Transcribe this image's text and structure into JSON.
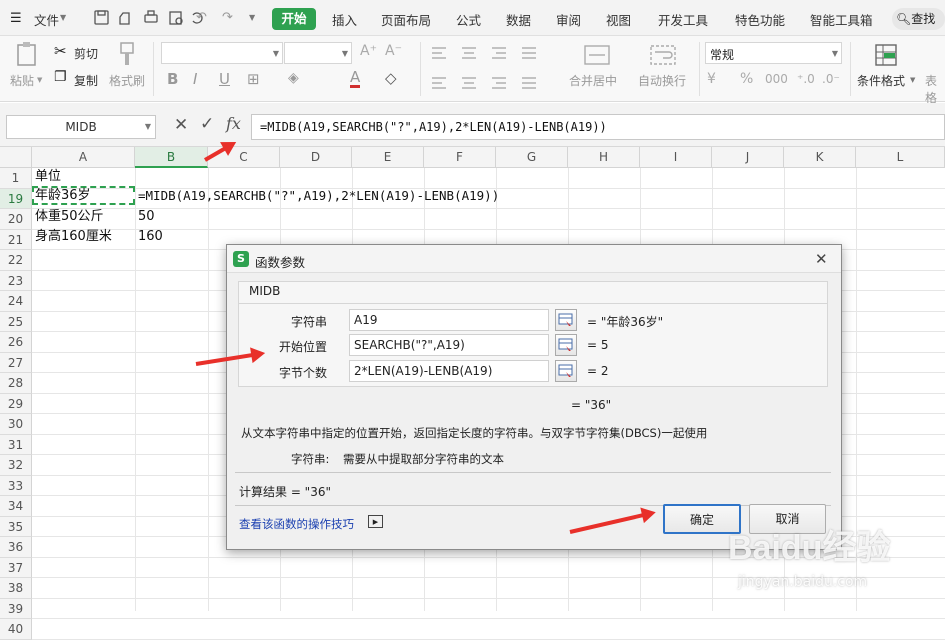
{
  "menubar": {
    "file": "文件",
    "tabs": [
      "开始",
      "插入",
      "页面布局",
      "公式",
      "数据",
      "审阅",
      "视图",
      "开发工具",
      "特色功能",
      "智能工具箱"
    ],
    "active_tab": "开始",
    "search": "查找"
  },
  "ribbon": {
    "paste": "粘贴",
    "cut": "剪切",
    "copy": "复制",
    "format_painter": "格式刷",
    "bold": "B",
    "italic": "I",
    "underline": "U",
    "merge": "合并居中",
    "wrap": "自动换行",
    "number_format": "常规",
    "conditional_format": "条件格式",
    "table_format": "表格"
  },
  "formula_bar": {
    "name_box": "MIDB",
    "fx": "fx",
    "formula": "=MIDB(A19,SEARCHB(\"?\",A19),2*LEN(A19)-LENB(A19))"
  },
  "columns": [
    "A",
    "B",
    "C",
    "D",
    "E",
    "F",
    "G",
    "H",
    "I",
    "J",
    "K",
    "L"
  ],
  "rows": [
    "1",
    "19",
    "20",
    "21",
    "22",
    "23",
    "24",
    "25",
    "26",
    "27",
    "28",
    "29",
    "30",
    "31",
    "32",
    "33",
    "34",
    "35",
    "36",
    "37",
    "38",
    "39",
    "40"
  ],
  "cells": {
    "A1": "单位",
    "A19": "年龄36岁",
    "B19": "=MIDB(A19,SEARCHB(\"?\",A19),2*LEN(A19)-LENB(A19))",
    "A20": "体重50公斤",
    "B20": "50",
    "A21": "身高160厘米",
    "B21": "160"
  },
  "dialog": {
    "title": "函数参数",
    "function_name": "MIDB",
    "args": [
      {
        "label": "字符串",
        "value": "A19",
        "result": "= \"年龄36岁\""
      },
      {
        "label": "开始位置",
        "value": "SEARCHB(\"?\",A19)",
        "result": "= 5"
      },
      {
        "label": "字节个数",
        "value": "2*LEN(A19)-LENB(A19)",
        "result": "= 2"
      }
    ],
    "overall_result": "= \"36\"",
    "description": "从文本字符串中指定的位置开始，返回指定长度的字符串。与双字节字符集(DBCS)一起使用",
    "param_help_label": "字符串:",
    "param_help_text": "需要从中提取部分字符串的文本",
    "calc_result": "计算结果 =  \"36\"",
    "help_link": "查看该函数的操作技巧",
    "ok": "确定",
    "cancel": "取消"
  },
  "watermark": "Baidu经验",
  "watermark_url": "jingyan.baidu.com",
  "colors": {
    "accent_green": "#2ea150",
    "arrow_red": "#e8302a",
    "link_blue": "#1a3fb0"
  }
}
